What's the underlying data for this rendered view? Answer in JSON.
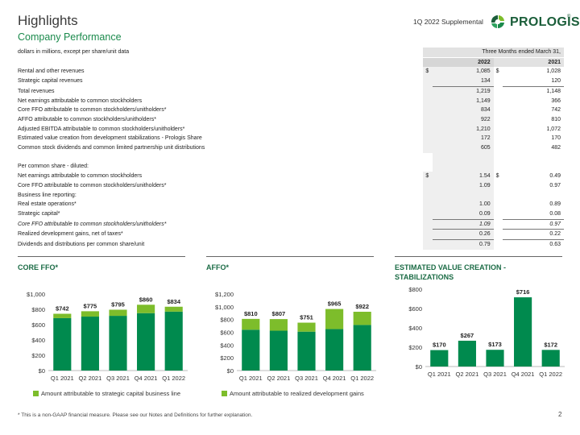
{
  "header": {
    "title": "Highlights",
    "subtitle": "Company Performance",
    "supplemental": "1Q 2022 Supplemental",
    "logo_text": "PROLOGIS",
    "logo_mark": "®"
  },
  "colors": {
    "dark_green": "#008a4e",
    "light_green": "#7dbd2b",
    "accent_text": "#1b8a4c"
  },
  "table": {
    "units_label": "dollars in millions, except per share/unit data",
    "period_header": "Three Months ended March 31,",
    "year_2022": "2022",
    "year_2021": "2021",
    "rows": [
      {
        "label": "Rental and other revenues",
        "cur22": "$",
        "v22": "1,085",
        "cur21": "$",
        "v21": "1,028",
        "indent": 0
      },
      {
        "label": "Strategic capital revenues",
        "cur22": "",
        "v22": "134",
        "cur21": "",
        "v21": "120",
        "indent": 0
      },
      {
        "label": "Total revenues",
        "cur22": "",
        "v22": "1,219",
        "cur21": "",
        "v21": "1,148",
        "indent": 1
      },
      {
        "label": "Net earnings attributable to common stockholders",
        "cur22": "",
        "v22": "1,149",
        "cur21": "",
        "v21": "366",
        "indent": 0
      },
      {
        "label": "Core FFO attributable to common stockholders/unitholders*",
        "cur22": "",
        "v22": "834",
        "cur21": "",
        "v21": "742",
        "indent": 0
      },
      {
        "label": "AFFO attributable to common stockholders/unitholders*",
        "cur22": "",
        "v22": "922",
        "cur21": "",
        "v21": "810",
        "indent": 0
      },
      {
        "label": "Adjusted EBITDA attributable to common stockholders/unitholders*",
        "cur22": "",
        "v22": "1,210",
        "cur21": "",
        "v21": "1,072",
        "indent": 0
      },
      {
        "label": "Estimated value creation from development stabilizations - Prologis Share",
        "cur22": "",
        "v22": "172",
        "cur21": "",
        "v21": "170",
        "indent": 0
      },
      {
        "label": "Common stock dividends and common limited partnership unit distributions",
        "cur22": "",
        "v22": "605",
        "cur21": "",
        "v21": "482",
        "indent": 0
      }
    ],
    "per_share_label": "Per common share - diluted:",
    "per_share_rows": [
      {
        "label": "Net earnings attributable to common stockholders",
        "cur22": "$",
        "v22": "1.54",
        "cur21": "$",
        "v21": "0.49",
        "indent": 1
      },
      {
        "label": "Core FFO attributable to common stockholders/unitholders*",
        "cur22": "",
        "v22": "1.09",
        "cur21": "",
        "v21": "0.97",
        "indent": 1
      },
      {
        "label": "Business line reporting:",
        "cur22": "",
        "v22": "",
        "cur21": "",
        "v21": "",
        "indent": 1
      },
      {
        "label": "Real estate operations*",
        "cur22": "",
        "v22": "1.00",
        "cur21": "",
        "v21": "0.89",
        "indent": 2
      },
      {
        "label": "Strategic capital*",
        "cur22": "",
        "v22": "0.09",
        "cur21": "",
        "v21": "0.08",
        "indent": 2
      },
      {
        "label": "Core FFO attributable to common stockholders/unitholders*",
        "cur22": "",
        "v22": "1.09",
        "cur21": "",
        "v21": "0.97",
        "indent": 2
      },
      {
        "label": "Realized development gains, net of taxes*",
        "cur22": "",
        "v22": "0.26",
        "cur21": "",
        "v21": "0.22",
        "indent": 2
      },
      {
        "label": "Dividends and distributions per common share/unit",
        "cur22": "",
        "v22": "0.79",
        "cur21": "",
        "v21": "0.63",
        "indent": 0
      }
    ]
  },
  "chart_data": [
    {
      "type": "bar",
      "title": "CORE FFO*",
      "categories": [
        "Q1 2021",
        "Q2 2021",
        "Q3 2021",
        "Q4 2021",
        "Q1 2022"
      ],
      "ylim": [
        0,
        1000
      ],
      "yticks": [
        "$0",
        "$200",
        "$400",
        "$600",
        "$800",
        "$1,000"
      ],
      "tick_values": [
        0,
        200,
        400,
        600,
        800,
        1000
      ],
      "stacked": true,
      "totals": [
        742,
        775,
        795,
        860,
        834
      ],
      "total_labels": [
        "$742",
        "$775",
        "$795",
        "$860",
        "$834"
      ],
      "series": [
        {
          "values": [
            685,
            705,
            715,
            750,
            770
          ],
          "color": "#008a4e"
        },
        {
          "name": "Amount attributable to strategic capital business line",
          "values": [
            57,
            70,
            80,
            110,
            64
          ],
          "color": "#7dbd2b"
        }
      ],
      "legend": "Amount attributable to strategic capital business line"
    },
    {
      "type": "bar",
      "title": "AFFO*",
      "categories": [
        "Q1 2021",
        "Q2 2021",
        "Q3 2021",
        "Q4 2021",
        "Q1 2022"
      ],
      "ylim": [
        0,
        1200
      ],
      "yticks": [
        "$0",
        "$200",
        "$400",
        "$600",
        "$800",
        "$1,000",
        "$1,200"
      ],
      "tick_values": [
        0,
        200,
        400,
        600,
        800,
        1000,
        1200
      ],
      "stacked": true,
      "totals": [
        810,
        807,
        751,
        965,
        922
      ],
      "total_labels": [
        "$810",
        "$807",
        "$751",
        "$965",
        "$922"
      ],
      "series": [
        {
          "values": [
            640,
            625,
            610,
            650,
            715
          ],
          "color": "#008a4e"
        },
        {
          "name": "Amount attributable to realized development gains",
          "values": [
            170,
            182,
            141,
            315,
            207
          ],
          "color": "#7dbd2b"
        }
      ],
      "legend": "Amount attributable to realized development gains"
    },
    {
      "type": "bar",
      "title": "ESTIMATED VALUE CREATION - STABILIZATIONS",
      "categories": [
        "Q1 2021",
        "Q2 2021",
        "Q3 2021",
        "Q4 2021",
        "Q1 2022"
      ],
      "ylim": [
        0,
        800
      ],
      "yticks": [
        "$0",
        "$200",
        "$400",
        "$600",
        "$800"
      ],
      "tick_values": [
        0,
        200,
        400,
        600,
        800
      ],
      "stacked": false,
      "totals": [
        170,
        267,
        173,
        716,
        172
      ],
      "total_labels": [
        "$170",
        "$267",
        "$173",
        "$716",
        "$172"
      ],
      "series": [
        {
          "values": [
            170,
            267,
            173,
            716,
            172
          ],
          "color": "#008a4e"
        }
      ],
      "legend": ""
    }
  ],
  "footer": {
    "note": "* This is a non-GAAP financial measure. Please see our Notes and Definitions for further explanation.",
    "page": "2"
  }
}
